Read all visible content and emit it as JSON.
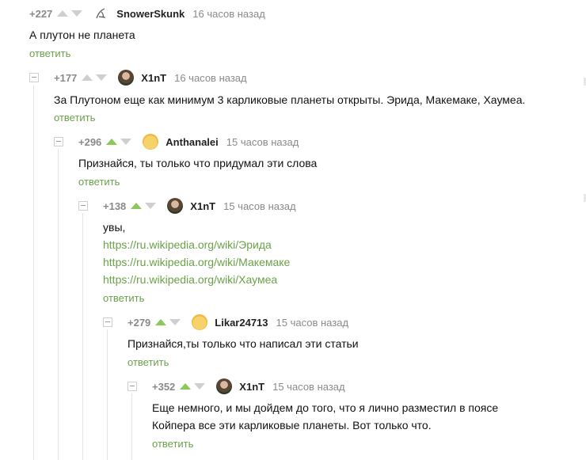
{
  "comments": [
    {
      "rating": "+227",
      "username": "SnowerSkunk",
      "time": "16 часов назад",
      "avatar": "sketch-avatar",
      "upvoted": false,
      "lines": [
        "А плутон не планета"
      ],
      "reply": "ответить"
    },
    {
      "rating": "+177",
      "username": "X1nT",
      "time": "16 часов назад",
      "avatar": "photo-avatar",
      "upvoted": false,
      "lines": [
        "За Плутоном еще как минимум 3 карликовые планеты открыты. Эрида, Макемаке, Хаумеа."
      ],
      "reply": "ответить"
    },
    {
      "rating": "+296",
      "username": "Anthanalei",
      "time": "15 часов назад",
      "avatar": "emoji-avatar",
      "upvoted": true,
      "lines": [
        "Признайся, ты только что придумал эти слова"
      ],
      "reply": "ответить"
    },
    {
      "rating": "+138",
      "username": "X1nT",
      "time": "15 часов назад",
      "avatar": "photo-avatar",
      "upvoted": true,
      "lines": [
        "увы,"
      ],
      "links": [
        "https://ru.wikipedia.org/wiki/Эрида",
        "https://ru.wikipedia.org/wiki/Макемаке",
        "https://ru.wikipedia.org/wiki/Хаумеа"
      ],
      "reply": "ответить"
    },
    {
      "rating": "+279",
      "username": "Likar24713",
      "time": "15 часов назад",
      "avatar": "emoji-avatar",
      "upvoted": true,
      "lines": [
        "Признайся,ты только что написал эти статьи"
      ],
      "reply": "ответить"
    },
    {
      "rating": "+352",
      "username": "X1nT",
      "time": "15 часов назад",
      "avatar": "photo-avatar",
      "upvoted": true,
      "lines": [
        "Еще немного, и мы дойдем до того, что я лично разместил в поясе",
        "Койпера все эти карликовые планеты. Вот только что."
      ],
      "reply": "ответить"
    }
  ],
  "colors": {
    "accent_green": "#6aa14a",
    "upvote_active": "#8ac858",
    "muted": "#8a8a8a"
  }
}
